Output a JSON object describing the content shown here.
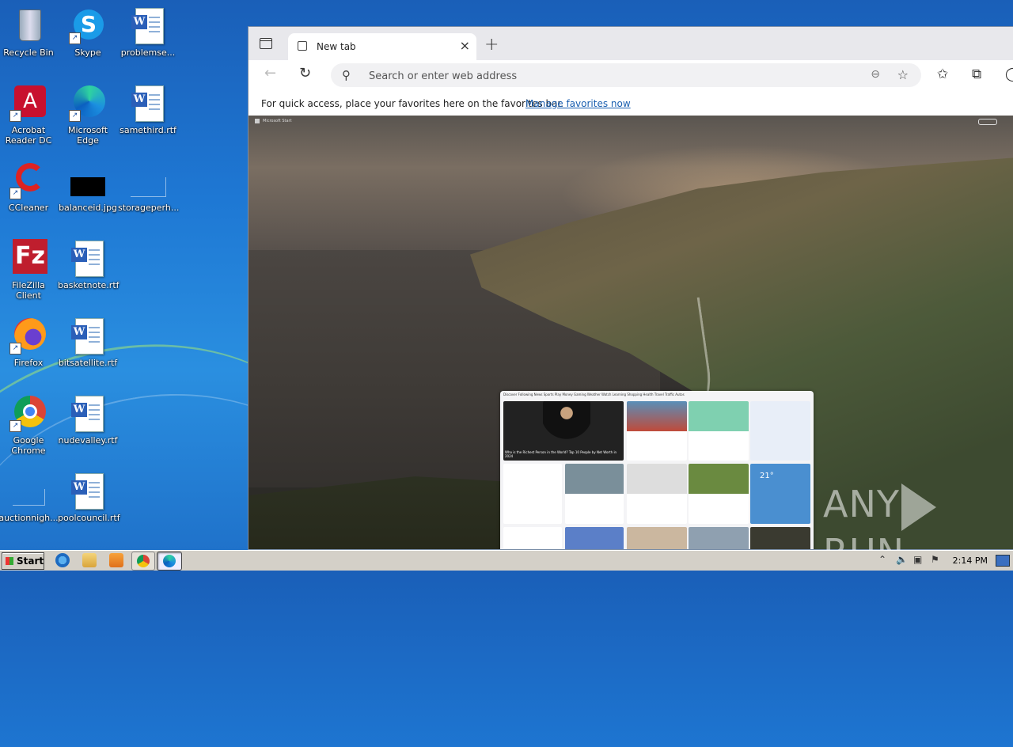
{
  "desktop": {
    "icons": [
      {
        "label": "Recycle Bin",
        "icon": "recycle-bin-icon"
      },
      {
        "label": "Skype",
        "icon": "skype-icon"
      },
      {
        "label": "problemse...",
        "icon": "word-doc-icon"
      },
      {
        "label": "Acrobat Reader DC",
        "icon": "acrobat-icon"
      },
      {
        "label": "Microsoft Edge",
        "icon": "edge-icon"
      },
      {
        "label": "samethird.rtf",
        "icon": "word-doc-icon"
      },
      {
        "label": "CCleaner",
        "icon": "ccleaner-icon"
      },
      {
        "label": "balanceid.jpg",
        "icon": "image-file-icon"
      },
      {
        "label": "storageperh...",
        "icon": "blank-file-icon"
      },
      {
        "label": "FileZilla Client",
        "icon": "filezilla-icon"
      },
      {
        "label": "basketnote.rtf",
        "icon": "word-doc-icon"
      },
      {
        "label": "Firefox",
        "icon": "firefox-icon"
      },
      {
        "label": "bitsatellite.rtf",
        "icon": "word-doc-icon"
      },
      {
        "label": "Google Chrome",
        "icon": "chrome-icon"
      },
      {
        "label": "nudevalley.rtf",
        "icon": "word-doc-icon"
      },
      {
        "label": "auctionnigh...",
        "icon": "blank-file-icon"
      },
      {
        "label": "poolcouncil.rtf",
        "icon": "word-doc-icon"
      }
    ]
  },
  "browser": {
    "tab_title": "New tab",
    "address_placeholder": "Search or enter web address",
    "favorites_message": "For quick access, place your favorites here on the favorites bar.",
    "favorites_link": "Manage favorites now",
    "ms_start": "Microsoft Start",
    "feed": {
      "nav": "Discover  Following  News  Sports  Play  Money  Gaming  Weather  Watch  Learning  Shopping  Health  Travel  Traffic  Autos",
      "headline": "Who is the Richest Person in the World? Top 10 People by Net Worth in 2024",
      "weather_temp": "21°"
    }
  },
  "taskbar": {
    "start_label": "Start",
    "clock": "2:14 PM"
  },
  "watermark": {
    "left": "ANY",
    "right": "RUN"
  }
}
